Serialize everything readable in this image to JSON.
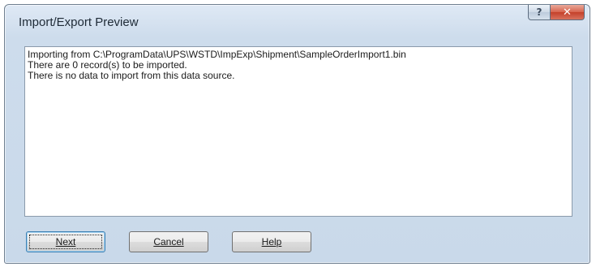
{
  "window": {
    "title": "Import/Export Preview",
    "help_glyph": "?",
    "close_glyph": "✕"
  },
  "log": {
    "lines": [
      "Importing from C:\\ProgramData\\UPS\\WSTD\\ImpExp\\Shipment\\SampleOrderImport1.bin",
      "There are 0 record(s) to be imported.",
      "There is no data to import from this data source."
    ]
  },
  "buttons": {
    "next_label": "Next",
    "cancel_label": "Cancel",
    "help_label": "Help"
  },
  "colors": {
    "window_frame": "#c9d9ea",
    "close_button": "#c4402a",
    "default_button_border": "#3c7fb1"
  }
}
